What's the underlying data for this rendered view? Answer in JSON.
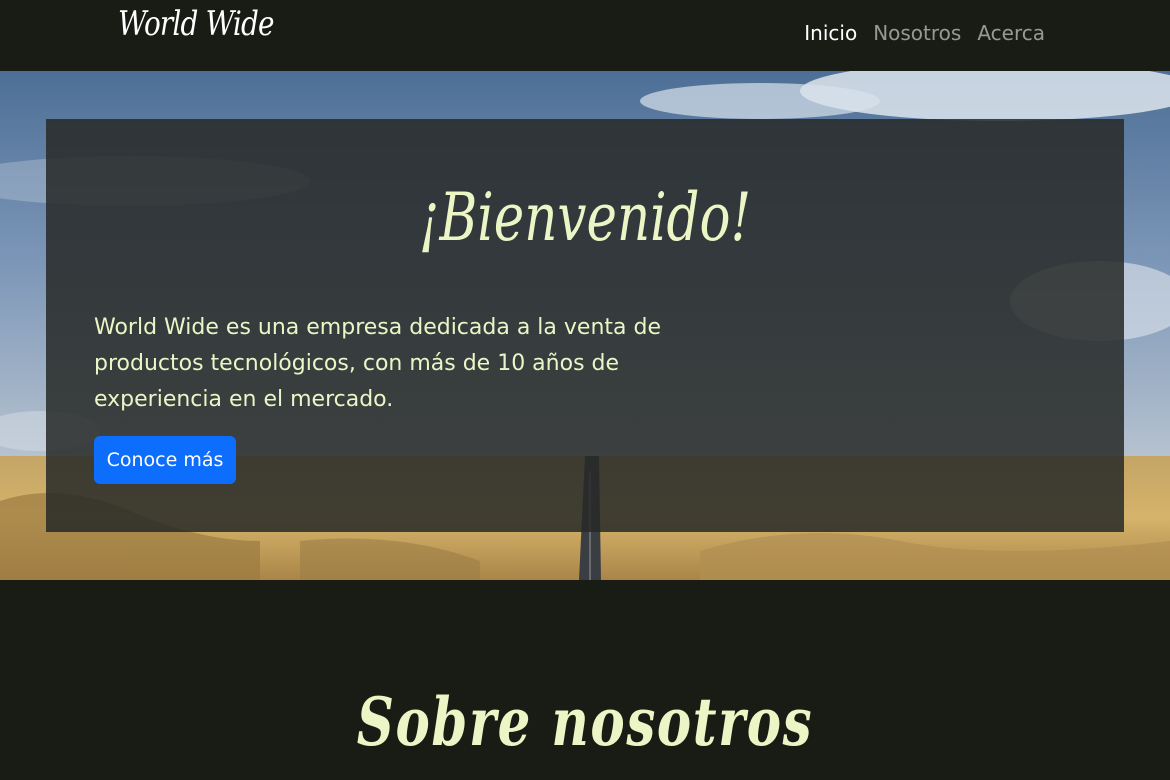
{
  "navbar": {
    "brand": "World Wide",
    "links": [
      {
        "label": "Inicio",
        "active": true
      },
      {
        "label": "Nosotros",
        "active": false
      },
      {
        "label": "Acerca",
        "active": false
      }
    ]
  },
  "hero": {
    "title": "¡Bienvenido!",
    "description": "World Wide es una empresa dedicada a la venta de productos tecnológicos, con más de 10 años de experiencia en el mercado.",
    "button_label": "Conoce más"
  },
  "about": {
    "title": "Sobre nosotros"
  },
  "colors": {
    "background": "#181c14",
    "accent_text": "#ecf5c6",
    "button": "#0d6efd"
  }
}
